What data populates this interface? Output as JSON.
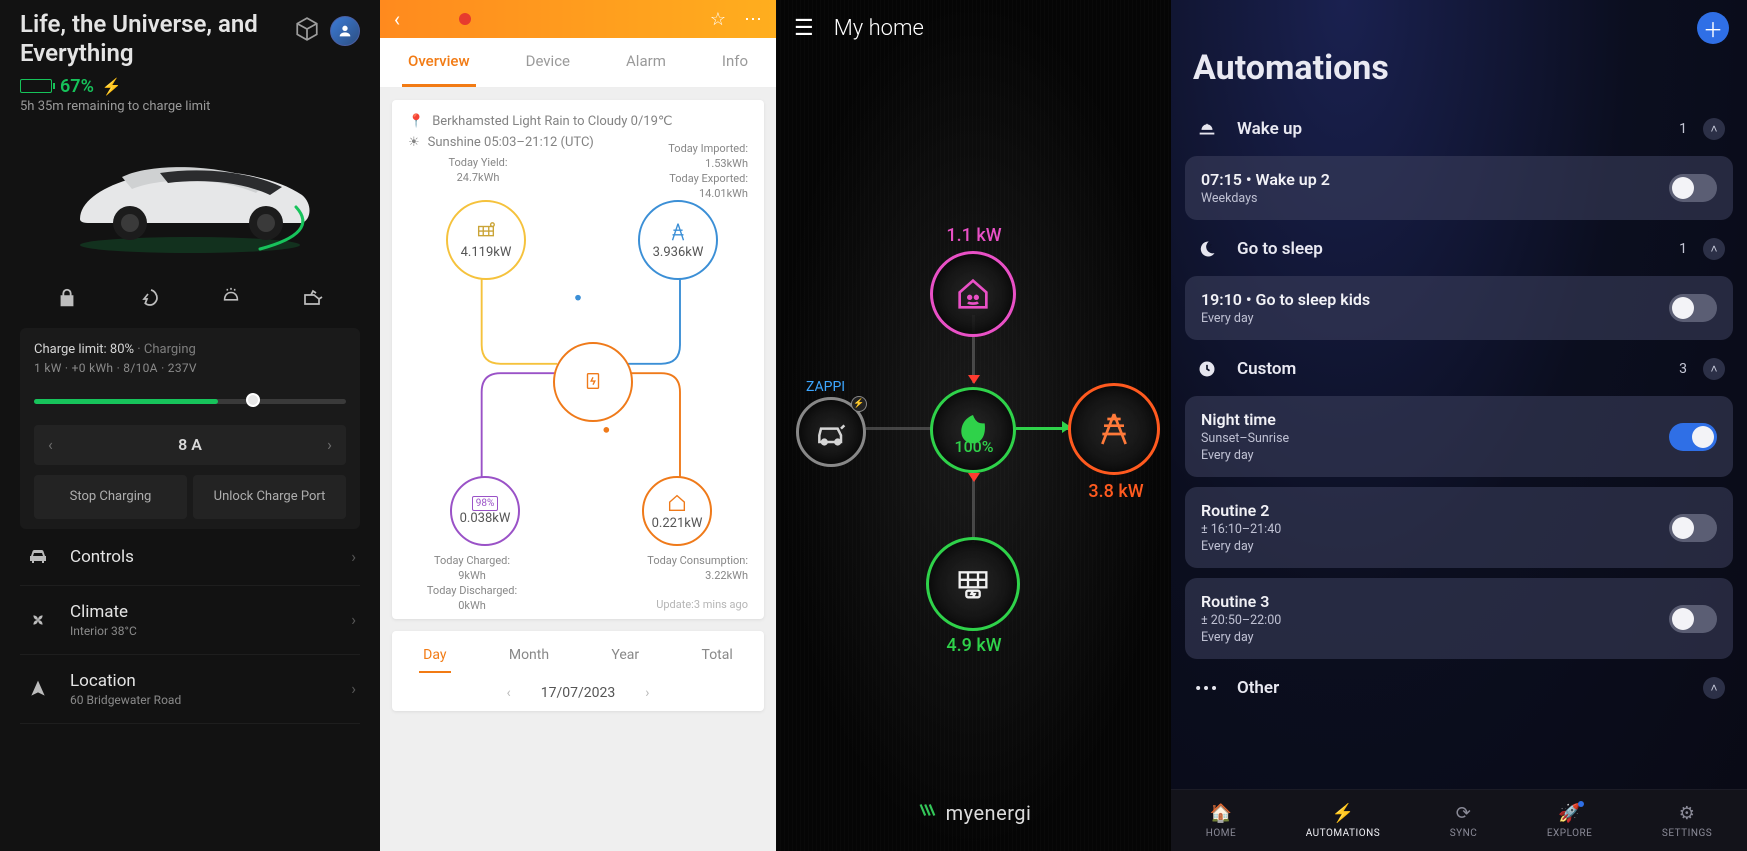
{
  "tesla": {
    "title": "Life, the Universe, and Everything",
    "battery_pct": "67%",
    "battery_fill_pct": 67,
    "remaining": "5h 35m remaining to charge limit",
    "charge_limit_label": "Charge limit: 80%",
    "charge_status": "Charging",
    "meter_line": "1 kW  ·  +0 kWh  ·  8/10A  ·  237V",
    "progress_pct": 59,
    "limit_pos_pct": 68,
    "amps": "8 A",
    "stop_btn": "Stop Charging",
    "unlock_btn": "Unlock Charge Port",
    "nav": {
      "controls": "Controls",
      "climate": "Climate",
      "climate_sub": "Interior 38°C",
      "location": "Location",
      "location_sub": "60 Bridgewater Road"
    }
  },
  "solis": {
    "tabs": {
      "overview": "Overview",
      "device": "Device",
      "alarm": "Alarm",
      "info": "Info"
    },
    "weather": "Berkhamsted Light Rain to Cloudy 0/19℃",
    "sun": "Sunshine 05:03–21:12 (UTC)",
    "yield_lbl": "Today Yield:",
    "yield_val": "24.7kWh",
    "imported_lbl": "Today Imported:",
    "imported_val": "1.53kWh",
    "exported_lbl": "Today Exported:",
    "exported_val": "14.01kWh",
    "pv_kw": "4.119kW",
    "grid_kw": "3.936kW",
    "batt_kw": "0.038kW",
    "batt_soc": "98%",
    "home_kw": "0.221kW",
    "charged_lbl": "Today Charged:",
    "charged_val": "9kWh",
    "discharged_lbl": "Today Discharged:",
    "discharged_val": "0kWh",
    "cons_lbl": "Today Consumption:",
    "cons_val": "3.22kWh",
    "update": "Update:3 mins ago",
    "range_tabs": {
      "day": "Day",
      "month": "Month",
      "year": "Year",
      "total": "Total"
    },
    "date": "17/07/2023"
  },
  "mye": {
    "title": "My home",
    "zappi_label": "ZAPPI",
    "home_kw": "1.1 kW",
    "leaf_pct": "100%",
    "grid_kw": "3.8 kW",
    "solar_kw": "4.9 kW",
    "brand": "myenergi"
  },
  "hue": {
    "heading": "Automations",
    "groups": {
      "wake": {
        "title": "Wake up",
        "count": "1"
      },
      "sleep": {
        "title": "Go to sleep",
        "count": "1"
      },
      "custom": {
        "title": "Custom",
        "count": "3"
      },
      "other": {
        "title": "Other"
      }
    },
    "cards": {
      "wake2": {
        "title": "07:15 • Wake up 2",
        "sub": "Weekdays"
      },
      "sleep_kids": {
        "title": "19:10 • Go to sleep kids",
        "sub": "Every day"
      },
      "night": {
        "title": "Night time",
        "sub1": "Sunset–Sunrise",
        "sub2": "Every day"
      },
      "r2": {
        "title": "Routine 2",
        "sub1": "± 16:10–21:40",
        "sub2": "Every day"
      },
      "r3": {
        "title": "Routine 3",
        "sub1": "± 20:50–22:00",
        "sub2": "Every day"
      }
    },
    "tabs": {
      "home": "HOME",
      "auto": "AUTOMATIONS",
      "sync": "SYNC",
      "explore": "EXPLORE",
      "settings": "SETTINGS"
    }
  }
}
